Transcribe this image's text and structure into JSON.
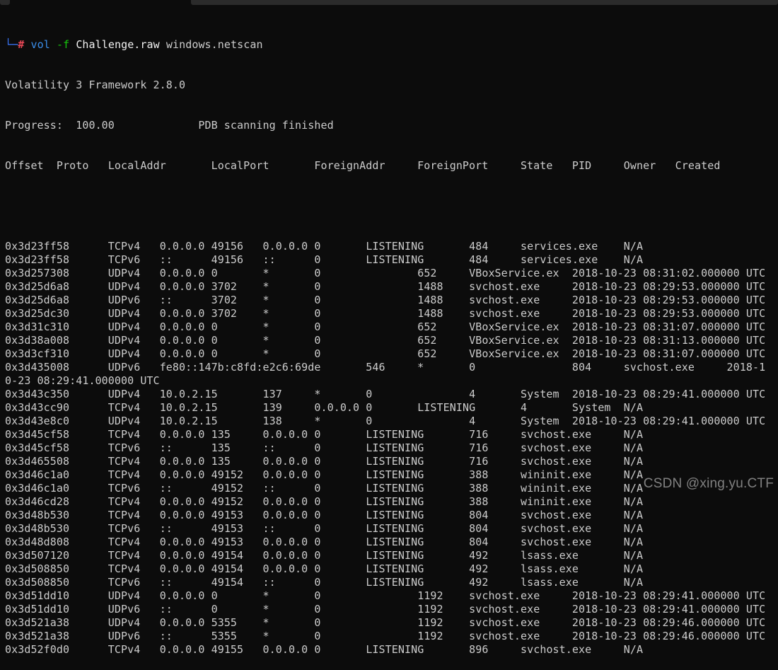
{
  "terminal": {
    "prompt": {
      "corner": "└─",
      "symbol": "#",
      "command": "vol",
      "flag": "-f",
      "file": "Challenge.raw",
      "plugin": "windows.netscan"
    },
    "banner": "Volatility 3 Framework 2.8.0",
    "progress": {
      "label": "Progress:",
      "value": "100.00",
      "status": "PDB scanning finished"
    },
    "columns": [
      "Offset",
      "Proto",
      "LocalAddr",
      "LocalPort",
      "ForeignAddr",
      "ForeignPort",
      "State",
      "PID",
      "Owner",
      "Created"
    ],
    "rows": [
      [
        "0x3d23ff58",
        "TCPv4",
        "0.0.0.0",
        "49156",
        "0.0.0.0",
        "0",
        "LISTENING",
        "484",
        "services.exe",
        "N/A"
      ],
      [
        "0x3d23ff58",
        "TCPv6",
        "::",
        "49156",
        "::",
        "0",
        "LISTENING",
        "484",
        "services.exe",
        "N/A"
      ],
      [
        "0x3d257308",
        "UDPv4",
        "0.0.0.0",
        "0",
        "*",
        "0",
        "",
        "652",
        "VBoxService.ex",
        "2018-10-23 08:31:02.000000 UTC"
      ],
      [
        "0x3d25d6a8",
        "UDPv4",
        "0.0.0.0",
        "3702",
        "*",
        "0",
        "",
        "1488",
        "svchost.exe",
        "2018-10-23 08:29:53.000000 UTC"
      ],
      [
        "0x3d25d6a8",
        "UDPv6",
        "::",
        "3702",
        "*",
        "0",
        "",
        "1488",
        "svchost.exe",
        "2018-10-23 08:29:53.000000 UTC"
      ],
      [
        "0x3d25dc30",
        "UDPv4",
        "0.0.0.0",
        "3702",
        "*",
        "0",
        "",
        "1488",
        "svchost.exe",
        "2018-10-23 08:29:53.000000 UTC"
      ],
      [
        "0x3d31c310",
        "UDPv4",
        "0.0.0.0",
        "0",
        "*",
        "0",
        "",
        "652",
        "VBoxService.ex",
        "2018-10-23 08:31:07.000000 UTC"
      ],
      [
        "0x3d38a008",
        "UDPv4",
        "0.0.0.0",
        "0",
        "*",
        "0",
        "",
        "652",
        "VBoxService.ex",
        "2018-10-23 08:31:13.000000 UTC"
      ],
      [
        "0x3d3cf310",
        "UDPv4",
        "0.0.0.0",
        "0",
        "*",
        "0",
        "",
        "652",
        "VBoxService.ex",
        "2018-10-23 08:31:07.000000 UTC"
      ],
      [
        "0x3d435008",
        "UDPv6",
        "fe80::147b:c8fd:e2c6:69de",
        "546",
        "*",
        "0",
        "",
        "804",
        "svchost.exe",
        "2018-10-23 08:29:41.000000 UTC"
      ],
      [
        "0x3d43c350",
        "UDPv4",
        "10.0.2.15",
        "137",
        "*",
        "0",
        "",
        "4",
        "System",
        "2018-10-23 08:29:41.000000 UTC"
      ],
      [
        "0x3d43cc90",
        "TCPv4",
        "10.0.2.15",
        "139",
        "0.0.0.0",
        "0",
        "LISTENING",
        "4",
        "System",
        "N/A"
      ],
      [
        "0x3d43e8c0",
        "UDPv4",
        "10.0.2.15",
        "138",
        "*",
        "0",
        "",
        "4",
        "System",
        "2018-10-23 08:29:41.000000 UTC"
      ],
      [
        "0x3d45cf58",
        "TCPv4",
        "0.0.0.0",
        "135",
        "0.0.0.0",
        "0",
        "LISTENING",
        "716",
        "svchost.exe",
        "N/A"
      ],
      [
        "0x3d45cf58",
        "TCPv6",
        "::",
        "135",
        "::",
        "0",
        "LISTENING",
        "716",
        "svchost.exe",
        "N/A"
      ],
      [
        "0x3d465508",
        "TCPv4",
        "0.0.0.0",
        "135",
        "0.0.0.0",
        "0",
        "LISTENING",
        "716",
        "svchost.exe",
        "N/A"
      ],
      [
        "0x3d46c1a0",
        "TCPv4",
        "0.0.0.0",
        "49152",
        "0.0.0.0",
        "0",
        "LISTENING",
        "388",
        "wininit.exe",
        "N/A"
      ],
      [
        "0x3d46c1a0",
        "TCPv6",
        "::",
        "49152",
        "::",
        "0",
        "LISTENING",
        "388",
        "wininit.exe",
        "N/A"
      ],
      [
        "0x3d46cd28",
        "TCPv4",
        "0.0.0.0",
        "49152",
        "0.0.0.0",
        "0",
        "LISTENING",
        "388",
        "wininit.exe",
        "N/A"
      ],
      [
        "0x3d48b530",
        "TCPv4",
        "0.0.0.0",
        "49153",
        "0.0.0.0",
        "0",
        "LISTENING",
        "804",
        "svchost.exe",
        "N/A"
      ],
      [
        "0x3d48b530",
        "TCPv6",
        "::",
        "49153",
        "::",
        "0",
        "LISTENING",
        "804",
        "svchost.exe",
        "N/A"
      ],
      [
        "0x3d48d808",
        "TCPv4",
        "0.0.0.0",
        "49153",
        "0.0.0.0",
        "0",
        "LISTENING",
        "804",
        "svchost.exe",
        "N/A"
      ],
      [
        "0x3d507120",
        "TCPv4",
        "0.0.0.0",
        "49154",
        "0.0.0.0",
        "0",
        "LISTENING",
        "492",
        "lsass.exe",
        "N/A"
      ],
      [
        "0x3d508850",
        "TCPv4",
        "0.0.0.0",
        "49154",
        "0.0.0.0",
        "0",
        "LISTENING",
        "492",
        "lsass.exe",
        "N/A"
      ],
      [
        "0x3d508850",
        "TCPv6",
        "::",
        "49154",
        "::",
        "0",
        "LISTENING",
        "492",
        "lsass.exe",
        "N/A"
      ],
      [
        "0x3d51dd10",
        "UDPv4",
        "0.0.0.0",
        "0",
        "*",
        "0",
        "",
        "1192",
        "svchost.exe",
        "2018-10-23 08:29:41.000000 UTC"
      ],
      [
        "0x3d51dd10",
        "UDPv6",
        "::",
        "0",
        "*",
        "0",
        "",
        "1192",
        "svchost.exe",
        "2018-10-23 08:29:41.000000 UTC"
      ],
      [
        "0x3d521a38",
        "UDPv4",
        "0.0.0.0",
        "5355",
        "*",
        "0",
        "",
        "1192",
        "svchost.exe",
        "2018-10-23 08:29:46.000000 UTC"
      ],
      [
        "0x3d521a38",
        "UDPv6",
        "::",
        "5355",
        "*",
        "0",
        "",
        "1192",
        "svchost.exe",
        "2018-10-23 08:29:46.000000 UTC"
      ],
      [
        "0x3d52f0d0",
        "TCPv4",
        "0.0.0.0",
        "49155",
        "0.0.0.0",
        "0",
        "LISTENING",
        "896",
        "svchost.exe",
        "N/A"
      ]
    ]
  },
  "watermark": "CSDN @xing.yu.CTF"
}
